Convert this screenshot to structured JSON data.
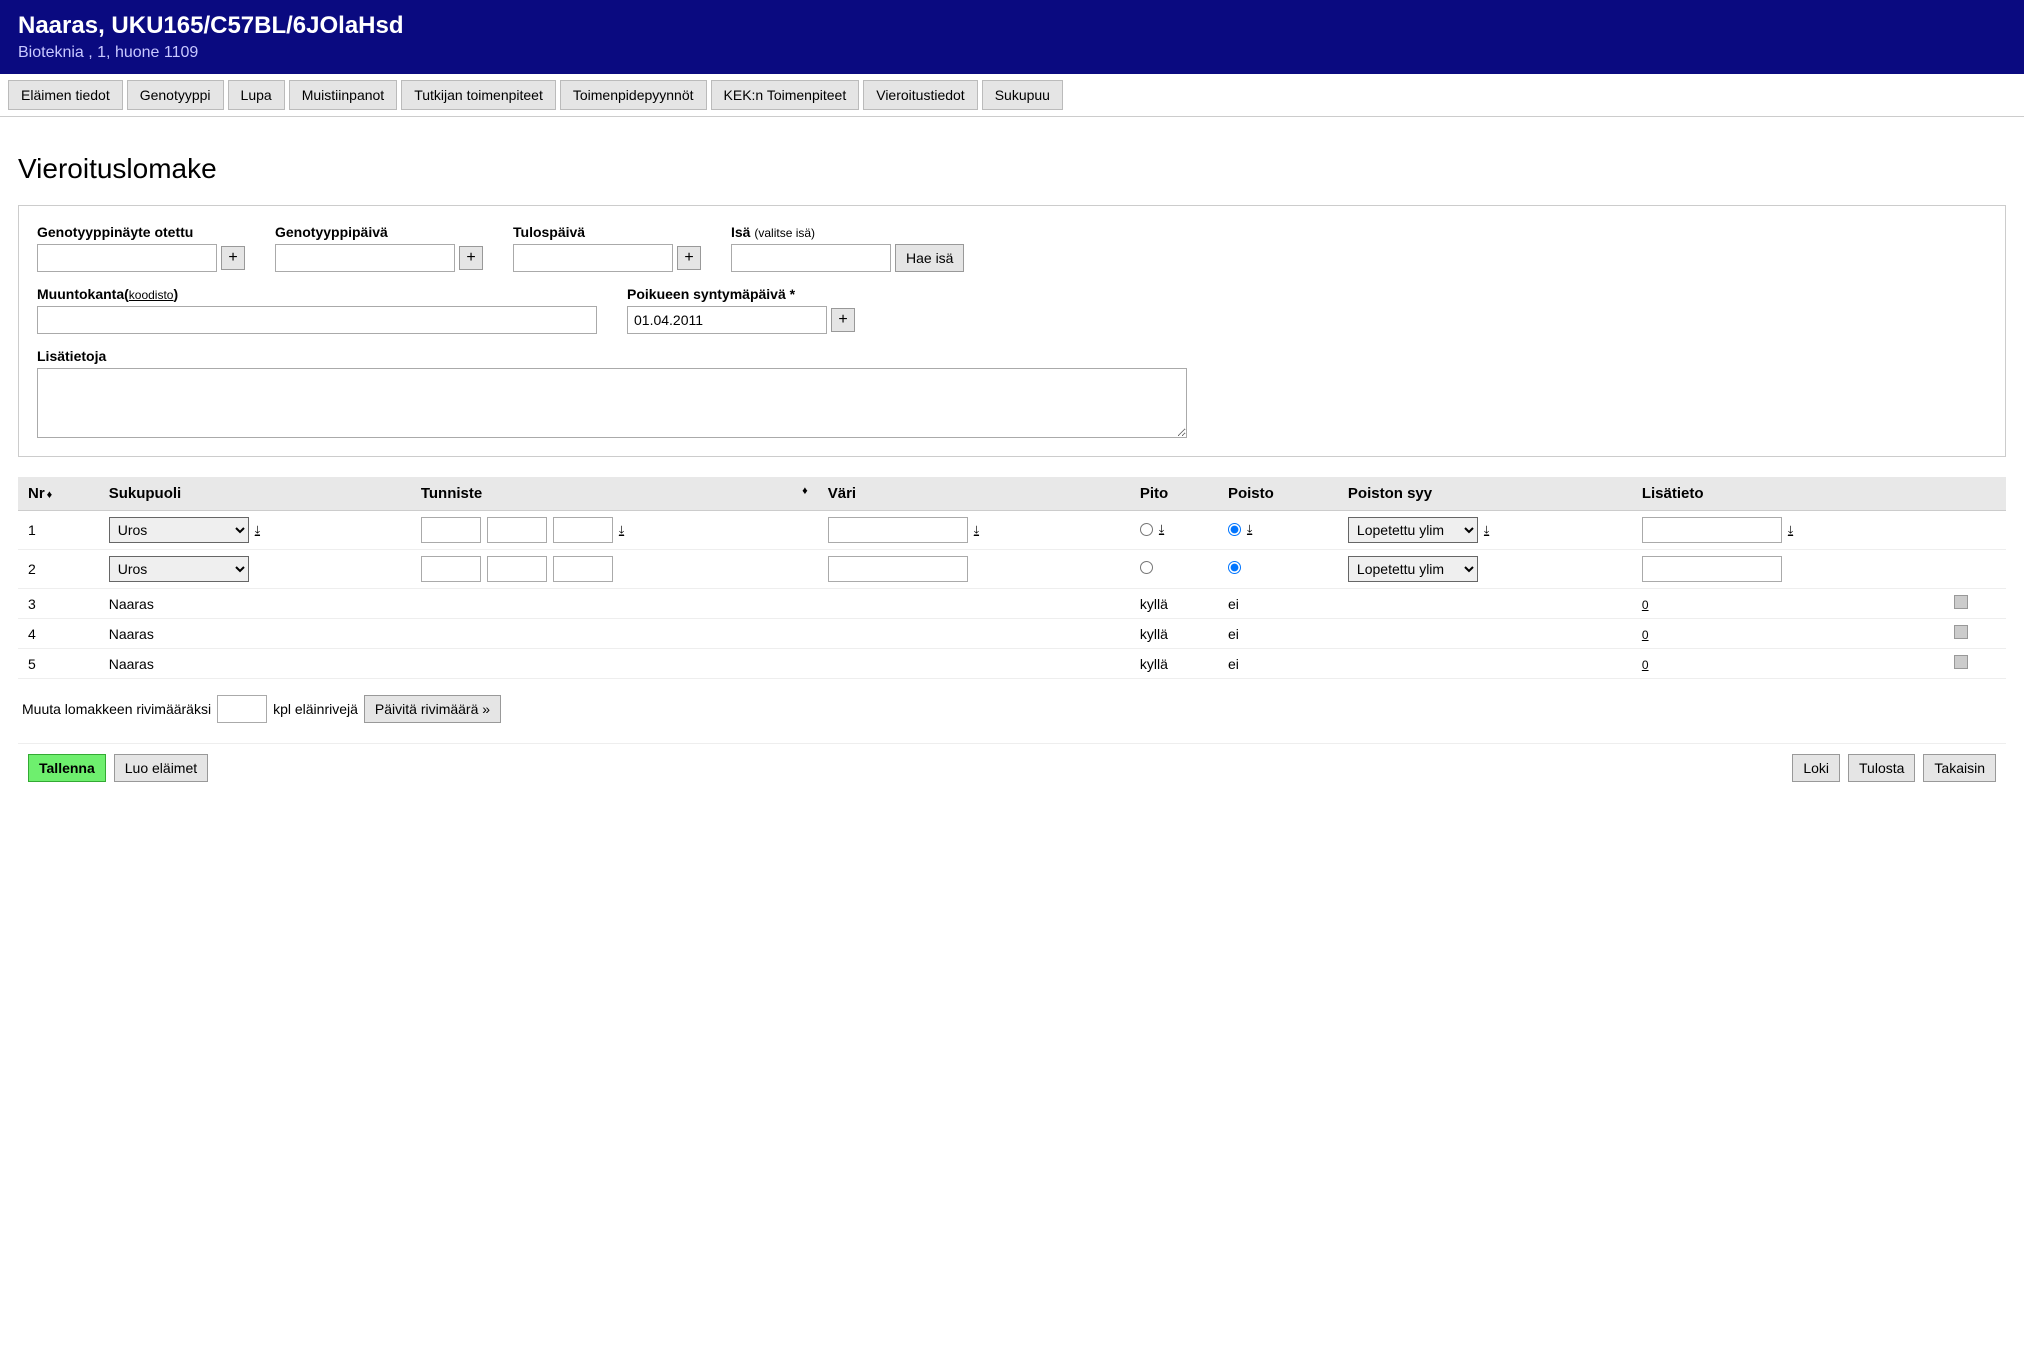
{
  "header": {
    "title": "Naaras, UKU165/C57BL/6JOlaHsd",
    "subtitle": "Bioteknia , 1, huone 1109"
  },
  "tabs": [
    "Eläimen tiedot",
    "Genotyyppi",
    "Lupa",
    "Muistiinpanot",
    "Tutkijan toimenpiteet",
    "Toimenpidepyynnöt",
    "KEK:n Toimenpiteet",
    "Vieroitustiedot",
    "Sukupuu"
  ],
  "page_title": "Vieroituslomake",
  "form": {
    "geno_sample": "Genotyyppinäyte otettu",
    "geno_day": "Genotyyppipäivä",
    "result_day": "Tulospäivä",
    "father_label": "Isä",
    "father_hint": "(valitse isä)",
    "fetch_father": "Hae isä",
    "strain": "Muuntokanta",
    "strain_link": "koodisto",
    "birthday_label": "Poikueen syntymäpäivä *",
    "birthday_value": "01.04.2011",
    "extra": "Lisätietoja",
    "plus": "+"
  },
  "table": {
    "headers": {
      "nr": "Nr",
      "sex": "Sukupuoli",
      "id": "Tunniste",
      "color": "Väri",
      "keep": "Pito",
      "remove": "Poisto",
      "reason": "Poiston syy",
      "info": "Lisätieto"
    },
    "uros": "Uros",
    "reason_opt": "Lopetettu ylim",
    "rows_static": [
      {
        "nr": "3",
        "sex": "Naaras",
        "keep": "kyllä",
        "remove": "ei",
        "info": "0"
      },
      {
        "nr": "4",
        "sex": "Naaras",
        "keep": "kyllä",
        "remove": "ei",
        "info": "0"
      },
      {
        "nr": "5",
        "sex": "Naaras",
        "keep": "kyllä",
        "remove": "ei",
        "info": "0"
      }
    ]
  },
  "rowline": {
    "pre": "Muuta lomakkeen rivimääräksi",
    "post": "kpl eläinrivejä",
    "btn": "Päivitä rivimäärä »"
  },
  "footer": {
    "save": "Tallenna",
    "create": "Luo eläimet",
    "log": "Loki",
    "print": "Tulosta",
    "back": "Takaisin"
  }
}
